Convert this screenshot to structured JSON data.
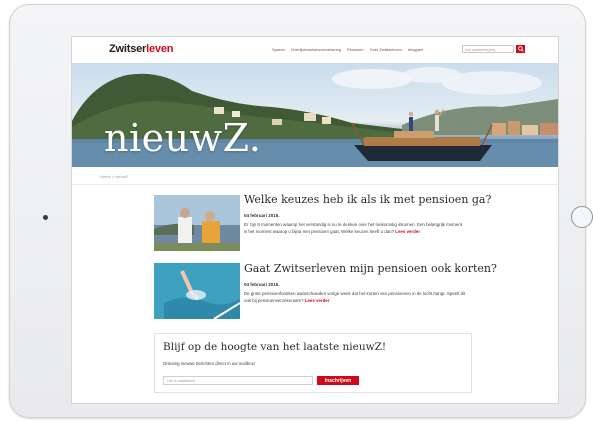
{
  "site": {
    "logo_part1": "Zwitser",
    "logo_part2": "leven",
    "nav": [
      "Sparen",
      "Overlijdensrisicoverzekering",
      "Pensioen",
      "Over Zwitserleven",
      "Inloggen"
    ],
    "search_placeholder": "Uw zoekterm(en)"
  },
  "hero": {
    "title": "nieuwZ."
  },
  "breadcrumb": "Home > nieuwZ",
  "articles": [
    {
      "title": "Welke keuzes heb ik als ik met pensioen ga?",
      "date": "04 februari 2016.",
      "text": "Er zijn 8 momenten waarop het verstandig is nu te denken over het toekomstig inkomen. Een belangrijk moment is het moment waarop u bijna met pensioen gaat. Welke keuzes heeft u dan?",
      "read_more": "Lees verder"
    },
    {
      "title": "Gaat Zwitserleven mijn pensioen ook korten?",
      "date": "04 februari 2016.",
      "text": "De grote pensioenfondsen waarschuwden vorige week dat het korten van pensioenen in de lucht hangt. Speelt dit ook bij pensioenverzekeraars?",
      "read_more": "Lees verder"
    }
  ],
  "newsletter": {
    "title": "Blijf op de hoogte van het laatste nieuwZ!",
    "subtitle": "Ontvang nieuwe berichten direct in uw mailbox!",
    "placeholder": "Uw e-mailadres",
    "button": "Inschrijven"
  },
  "colors": {
    "brand_red": "#cc0a1a"
  }
}
